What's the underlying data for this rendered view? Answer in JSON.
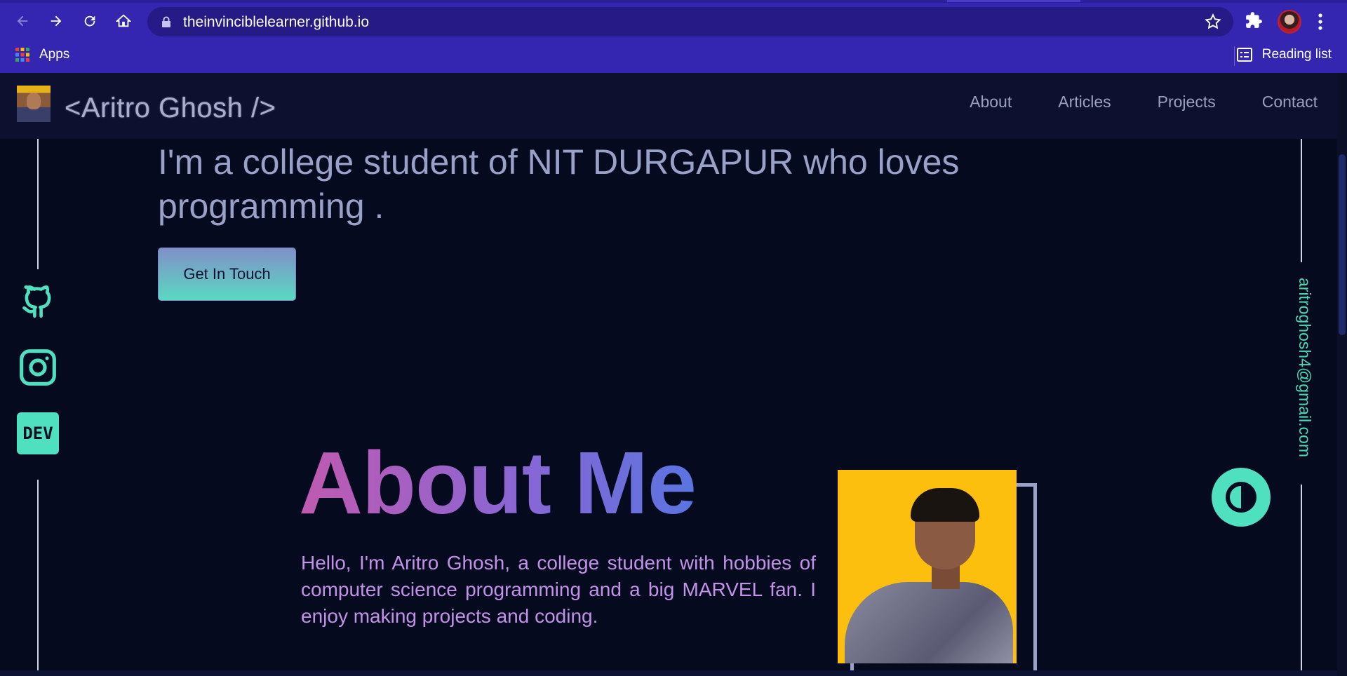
{
  "browser": {
    "url": "theinvinciblelearner.github.io",
    "bookmarks": {
      "apps_label": "Apps",
      "reading_list_label": "Reading list"
    }
  },
  "site": {
    "brand": "<Aritro Ghosh />",
    "nav": [
      "About",
      "Articles",
      "Projects",
      "Contact"
    ],
    "hero_text": "I'm a college student of NIT DURGAPUR who loves programming .",
    "cta_label": "Get In Touch",
    "email": "aritroghosh4@gmail.com",
    "social": {
      "dev_label": "DEV"
    },
    "about": {
      "title": "About Me",
      "body": "Hello, I'm Aritro Ghosh, a college student with hobbies of computer science programming and a big MARVEL fan. I enjoy making projects and coding."
    }
  },
  "colors": {
    "chrome": "#3426b0",
    "page_bg": "#060a1e",
    "accent_teal": "#4fe0bf",
    "about_text": "#c292e8"
  }
}
